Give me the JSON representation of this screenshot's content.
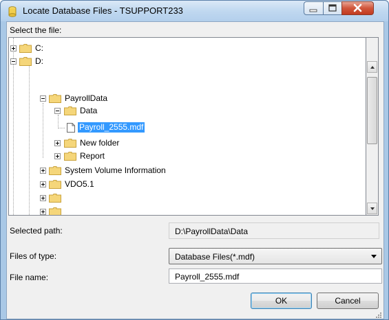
{
  "window": {
    "title": "Locate Database Files - TSUPPORT233"
  },
  "labels": {
    "select_file": "Select the file:",
    "selected_path": "Selected path:",
    "files_of_type": "Files of type:",
    "file_name": "File name:"
  },
  "tree": {
    "nodes": {
      "c": "C:",
      "d": "D:",
      "payrolldata": "PayrollData",
      "data": "Data",
      "payroll_file": "Payroll_2555.mdf",
      "new_folder": "New folder",
      "report": "Report",
      "svi": "System Volume Information",
      "vdo": "VDO5.1"
    },
    "selected": "Payroll_2555.mdf"
  },
  "fields": {
    "selected_path_value": "D:\\PayrollData\\Data",
    "files_of_type_value": "Database Files(*.mdf)",
    "file_name_value": "Payroll_2555.mdf"
  },
  "buttons": {
    "ok": "OK",
    "cancel": "Cancel"
  },
  "colors": {
    "selection": "#3399ff",
    "folder": "#f5d67a",
    "titlebar": "#c0d8f0",
    "close": "#c94a30"
  },
  "icons": [
    "database-icon",
    "minimize-icon",
    "maximize-icon",
    "close-icon",
    "folder-icon",
    "file-icon",
    "expand-icon",
    "collapse-icon",
    "scroll-up-icon",
    "scroll-down-icon",
    "dropdown-arrow-icon",
    "resize-grip-icon"
  ]
}
